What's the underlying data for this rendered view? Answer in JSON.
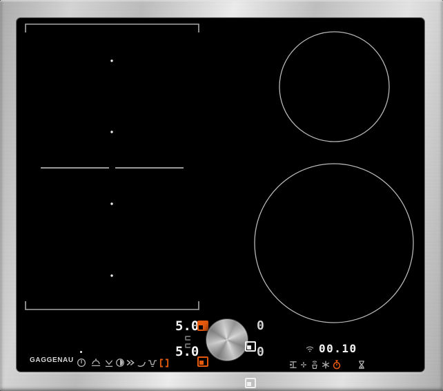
{
  "device": {
    "brand": "GAGGENAU",
    "type": "induction cooktop with twist-pad control"
  },
  "colors": {
    "accent_orange": "#e65a0e",
    "glass_black": "#000000",
    "zone_outline_gray": "#b0b0b0",
    "display_white": "#f4f4f4",
    "display_idle_white": "#d2d2d2",
    "icon_gray": "#b4b4b4",
    "steel_light": "#efefef",
    "steel_dark": "#a8a8a8"
  },
  "cooking_zones": {
    "flex_left": {
      "name": "flex cooking zone",
      "marker_dots": 4,
      "split_divider": true
    },
    "back_right": {
      "name": "small round zone"
    },
    "front_right": {
      "name": "large round zone"
    }
  },
  "control_panel": {
    "brand_label": "GAGGENAU",
    "power_indicator_on": true,
    "function_icons_left": [
      "power-icon",
      "keep-warm-icon",
      "melt-icon",
      "auto-cook-icon",
      "boost-icon",
      "frying-sensor-icon",
      "teppanyaki-icon",
      "flex-zone-icon"
    ],
    "flex_zone_icon_active": true,
    "zone_controls": {
      "back_left": {
        "value": "5.0",
        "state": "active"
      },
      "front_left": {
        "value": "5.0",
        "state": "active"
      },
      "back_right": {
        "value": "0",
        "state": "idle"
      },
      "front_right": {
        "value": "0",
        "state": "idle"
      }
    },
    "timer": {
      "wifi_indicator": true,
      "display_value": "00.10",
      "icons_right": [
        "pan-transfer-icon",
        "fan-icon",
        "cookware-signal-icon",
        "snowflake-icon",
        "stopwatch-icon",
        "hourglass-icon"
      ],
      "stopwatch_active": true
    }
  }
}
